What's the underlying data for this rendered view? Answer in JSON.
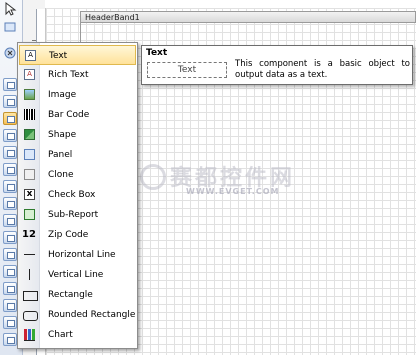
{
  "header_band": {
    "label": "HeaderBand1"
  },
  "component_menu": {
    "items": [
      {
        "label": "Text",
        "icon": "text-component-icon"
      },
      {
        "label": "Rich Text",
        "icon": "rich-text-icon"
      },
      {
        "label": "Image",
        "icon": "image-icon"
      },
      {
        "label": "Bar Code",
        "icon": "barcode-icon"
      },
      {
        "label": "Shape",
        "icon": "shape-icon"
      },
      {
        "label": "Panel",
        "icon": "panel-icon"
      },
      {
        "label": "Clone",
        "icon": "clone-icon"
      },
      {
        "label": "Check Box",
        "icon": "checkbox-icon"
      },
      {
        "label": "Sub-Report",
        "icon": "subreport-icon"
      },
      {
        "label": "Zip Code",
        "icon": "zipcode-icon"
      },
      {
        "label": "Horizontal Line",
        "icon": "horizontal-line-icon"
      },
      {
        "label": "Vertical Line",
        "icon": "vertical-line-icon"
      },
      {
        "label": "Rectangle",
        "icon": "rectangle-icon"
      },
      {
        "label": "Rounded Rectangle",
        "icon": "rounded-rectangle-icon"
      },
      {
        "label": "Chart",
        "icon": "chart-icon"
      }
    ],
    "selected": "Text",
    "zip_glyph": "12",
    "check_glyph": "x"
  },
  "tooltip": {
    "title": "Text",
    "sample": "Text",
    "description": "This component is a basic object to output data as a text."
  },
  "watermark": {
    "main": "赛都控件网",
    "sub": "WWW.EVGET.COM"
  }
}
